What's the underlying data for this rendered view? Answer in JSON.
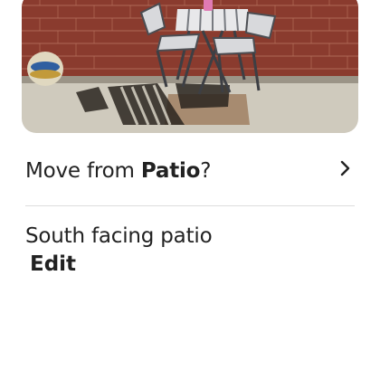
{
  "photo": {
    "alt_icon": "patio-photo"
  },
  "move_row": {
    "prefix": "Move from ",
    "space_name": "Patio",
    "suffix": "?",
    "chevron_icon": "chevron-right-icon"
  },
  "description": {
    "text": "South facing patio"
  },
  "edit_link": {
    "label": "Edit"
  }
}
